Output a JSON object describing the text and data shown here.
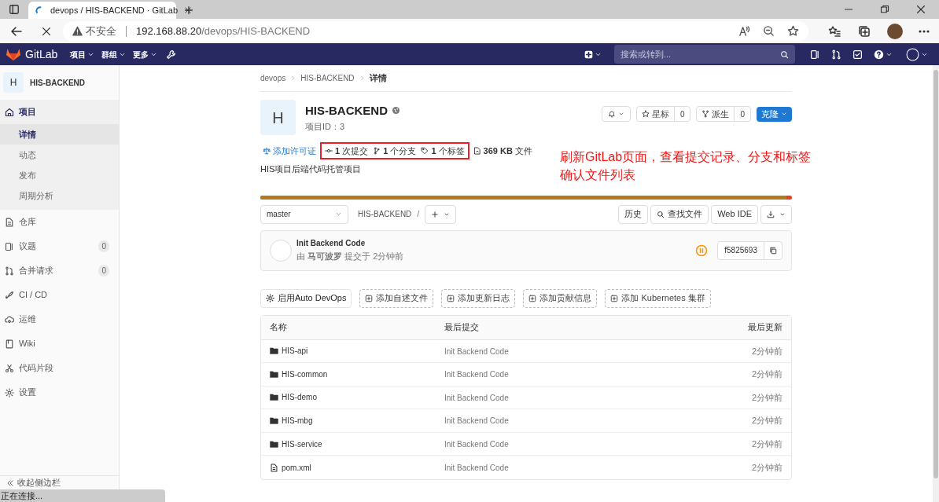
{
  "browser": {
    "tab_title": "devops / HIS-BACKEND · GitLab",
    "security": "不安全",
    "url_host": "192.168.88.20",
    "url_path": "/devops/HIS-BACKEND",
    "loading": true
  },
  "navbar": {
    "brand": "GitLab",
    "menus": [
      "项目",
      "群组",
      "更多"
    ],
    "search_placeholder": "搜索或转到..."
  },
  "sidebar": {
    "project": "HIS-BACKEND",
    "avatar": "H",
    "items": [
      {
        "label": "项目",
        "selected": true,
        "children": [
          {
            "label": "详情",
            "selected": true
          },
          {
            "label": "动态",
            "selected": false
          },
          {
            "label": "发布",
            "selected": false
          },
          {
            "label": "周期分析",
            "selected": false
          }
        ]
      },
      {
        "label": "仓库",
        "selected": false
      },
      {
        "label": "议题",
        "selected": false,
        "count": "0"
      },
      {
        "label": "合并请求",
        "selected": false,
        "count": "0"
      },
      {
        "label": "CI / CD",
        "selected": false
      },
      {
        "label": "运维",
        "selected": false
      },
      {
        "label": "Wiki",
        "selected": false
      },
      {
        "label": "代码片段",
        "selected": false
      },
      {
        "label": "设置",
        "selected": false
      }
    ],
    "collapse": "收起侧边栏"
  },
  "breadcrumb": [
    "devops",
    "HIS-BACKEND",
    "详情"
  ],
  "project": {
    "avatar": "H",
    "name": "HIS-BACKEND",
    "id_label": "项目ID：3",
    "star_label": "星标",
    "star_count": "0",
    "fork_label": "派生",
    "fork_count": "0",
    "clone_label": "克隆"
  },
  "stats": [
    {
      "kind": "license",
      "text": "添加许可证",
      "highlighted": false
    },
    {
      "kind": "commit",
      "text": "**1** 次提交",
      "highlighted": true
    },
    {
      "kind": "branch",
      "text": "**1** 个分支",
      "highlighted": true
    },
    {
      "kind": "tag",
      "text": "**1** 个标签",
      "highlighted": true
    },
    {
      "kind": "files",
      "text": "**369 KB** 文件",
      "highlighted": false
    }
  ],
  "description": "HIS项目后端代码托管项目",
  "annotation": [
    "刷新GitLab页面，查看提交记录、分支和标签",
    "确认文件列表"
  ],
  "storage_bar": {
    "level": 0.99
  },
  "repo_bar": {
    "branch": "master",
    "path": "HIS-BACKEND",
    "separator": "/",
    "buttons": [
      "历史",
      "查找文件",
      "Web IDE"
    ]
  },
  "last_commit": {
    "title": "Init Backend Code",
    "meta": "由 **马可波罗** 提交于 2分钟前",
    "sha": "f5825693"
  },
  "quick_actions": [
    {
      "label": "启用Auto DevOps",
      "kind": "solid"
    },
    {
      "label": "添加自述文件",
      "kind": "dashed"
    },
    {
      "label": "添加更新日志",
      "kind": "dashed"
    },
    {
      "label": "添加贡献信息",
      "kind": "dashed"
    },
    {
      "label": "添加 Kubernetes 集群",
      "kind": "dashed"
    }
  ],
  "files": {
    "columns": [
      "名称",
      "最后提交",
      "最后更新"
    ],
    "rows": [
      {
        "kind": "folder",
        "name": "HIS-api",
        "commit": "Init Backend Code",
        "updated": "2分钟前"
      },
      {
        "kind": "folder",
        "name": "HIS-common",
        "commit": "Init Backend Code",
        "updated": "2分钟前"
      },
      {
        "kind": "folder",
        "name": "HIS-demo",
        "commit": "Init Backend Code",
        "updated": "2分钟前"
      },
      {
        "kind": "folder",
        "name": "HIS-mbg",
        "commit": "Init Backend Code",
        "updated": "2分钟前"
      },
      {
        "kind": "folder",
        "name": "HIS-service",
        "commit": "Init Backend Code",
        "updated": "2分钟前"
      },
      {
        "kind": "file",
        "name": "pom.xml",
        "commit": "Init Backend Code",
        "updated": "2分钟前"
      }
    ]
  },
  "status_bar": "正在连接..."
}
